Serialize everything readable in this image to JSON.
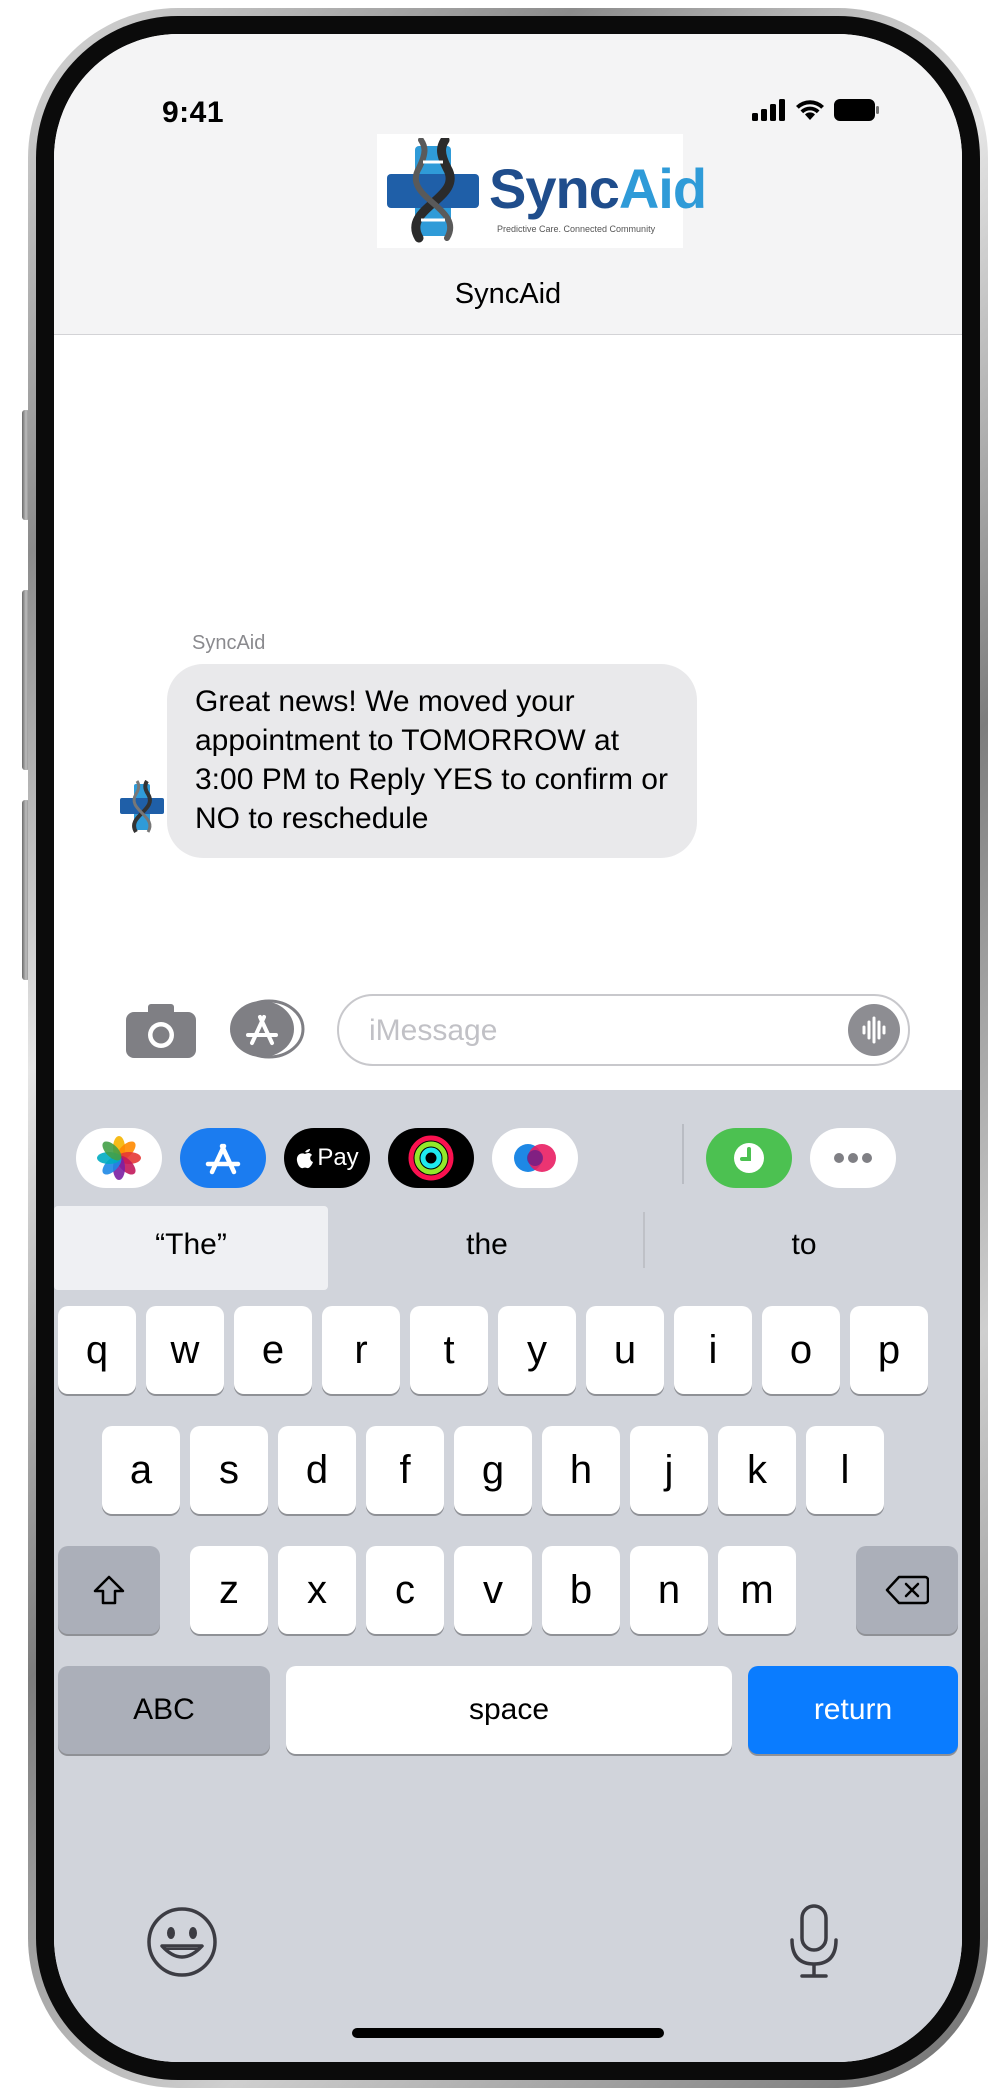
{
  "status_bar": {
    "time": "9:41"
  },
  "header": {
    "logo": {
      "word_a": "Sync",
      "word_b": "Aid",
      "tagline": "Predictive Care. Connected Community"
    },
    "contact_name": "SyncAid"
  },
  "conversation": {
    "messages": [
      {
        "sender": "SyncAid",
        "text": "Great news! We moved your appointment to TOMORROW at 3:00 PM to Reply YES to confirm or NO to reschedule"
      }
    ]
  },
  "composer": {
    "placeholder": "iMessage"
  },
  "app_strip": {
    "items": [
      "photos-icon",
      "app-store-icon",
      "apple-pay-icon",
      "activity-icon",
      "digital-touch-icon",
      "clock-icon",
      "more-icon"
    ],
    "apple_pay_label": "Pay"
  },
  "suggestions": [
    "“The”",
    "the",
    "to"
  ],
  "keyboard": {
    "row1": [
      "q",
      "w",
      "e",
      "r",
      "t",
      "y",
      "u",
      "i",
      "o",
      "p"
    ],
    "row2": [
      "a",
      "s",
      "d",
      "f",
      "g",
      "h",
      "j",
      "k",
      "l"
    ],
    "row3": [
      "z",
      "x",
      "c",
      "v",
      "b",
      "n",
      "m"
    ],
    "abc_label": "ABC",
    "space_label": "space",
    "return_label": "return"
  },
  "colors": {
    "accent_blue": "#0a7cff",
    "bubble_gray": "#e9e9eb",
    "keyboard_bg": "#d1d4db",
    "logo_dark_blue": "#1f4d8c",
    "logo_light_blue": "#2f9bd8"
  }
}
